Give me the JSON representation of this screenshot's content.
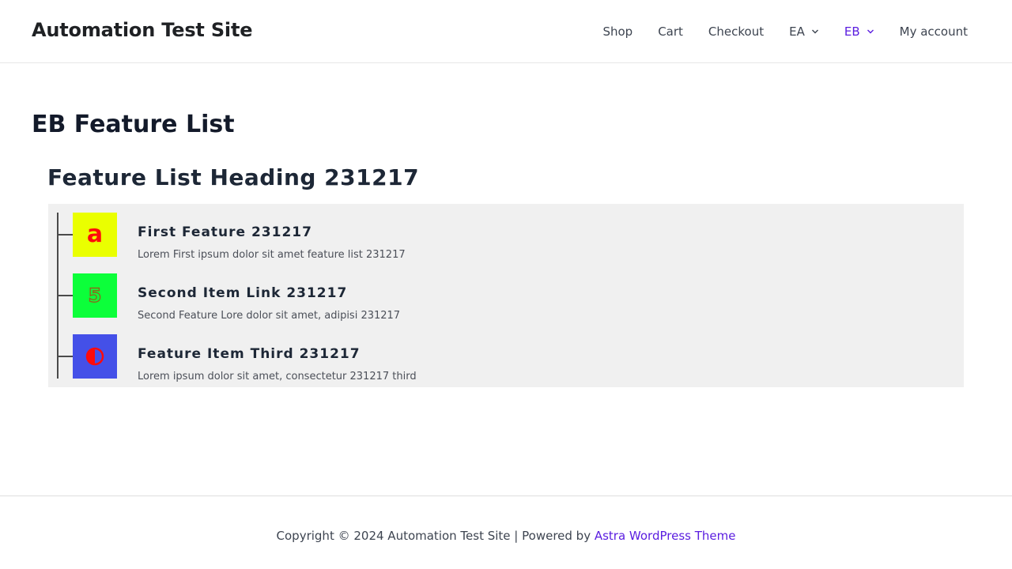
{
  "header": {
    "site_title": "Automation Test Site",
    "nav": [
      {
        "label": "Shop"
      },
      {
        "label": "Cart"
      },
      {
        "label": "Checkout"
      },
      {
        "label": "EA"
      },
      {
        "label": "EB"
      },
      {
        "label": "My account"
      }
    ],
    "active_nav": "EB",
    "accent_color": "#5b1ee0"
  },
  "main": {
    "page_title": "EB Feature List",
    "feature_list": {
      "heading": "Feature List Heading 231217",
      "items": [
        {
          "title": "First Feature 231217",
          "description": "Lorem First ipsum dolor sit amet feature list 231217",
          "icon": "letter-a-icon",
          "icon_bg": "#eaff00",
          "icon_color": "#ff0a0a"
        },
        {
          "title": "Second Item Link 231217",
          "description": "Second Feature Lore dolor sit amet, adipisi 231217",
          "icon": "digit-five-icon",
          "icon_bg": "#0cff3a",
          "icon_color": "#8a6a1a"
        },
        {
          "title": "Feature Item Third 231217",
          "description": "Lorem ipsum dolor sit amet, consectetur 231217 third",
          "icon": "half-circle-icon",
          "icon_bg": "#4450e8",
          "icon_color": "#ff0a0a"
        }
      ]
    }
  },
  "footer": {
    "copyright": "Copyright © 2024 Automation Test Site | Powered by ",
    "link_text": "Astra WordPress Theme"
  }
}
